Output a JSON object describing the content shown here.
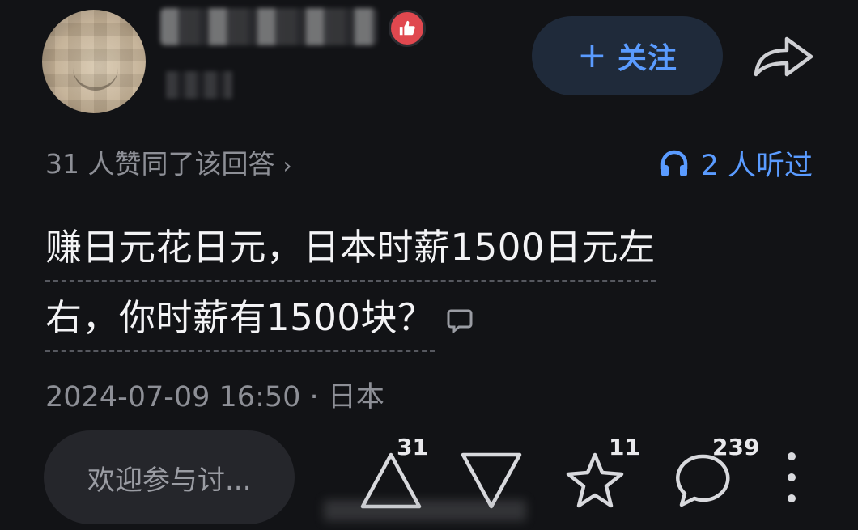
{
  "header": {
    "follow_label": "关注",
    "follow_plus": "+"
  },
  "meta": {
    "agree_text": "31 人赞同了该回答",
    "agree_chevron": "›",
    "listen_text": "2 人听过"
  },
  "answer": {
    "line1": "赚日元花日元，日本时薪1500日元左",
    "line2": "右，你时薪有1500块？"
  },
  "timestamp": {
    "datetime": "2024-07-09 16:50",
    "separator": "·",
    "location": "日本"
  },
  "bottom_bar": {
    "input_placeholder": "欢迎参与讨...",
    "upvote_count": "31",
    "star_count": "11",
    "comment_count": "239"
  },
  "icons": {
    "badge": "thumbs-up-icon",
    "share": "share-arrow-icon",
    "listen": "headphones-icon",
    "inline_comment": "comment-bubble-icon",
    "upvote": "upvote-triangle-icon",
    "downvote": "downvote-triangle-icon",
    "star": "star-icon",
    "comment": "comment-icon",
    "more": "more-vertical-icon"
  },
  "colors": {
    "background": "#121316",
    "accent": "#5a9bff",
    "badge": "#e0484f",
    "muted_text": "#8d8f96"
  }
}
